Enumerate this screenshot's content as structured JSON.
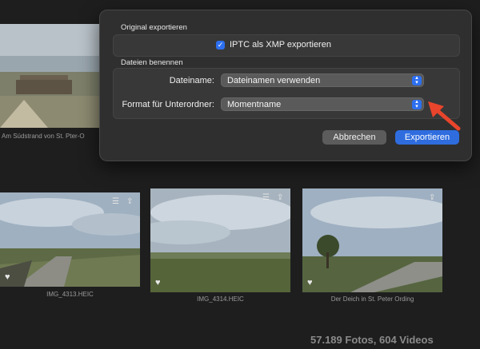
{
  "dialog": {
    "section_original": "Original exportieren",
    "iptc_label": "IPTC als XMP exportieren",
    "iptc_checked": true,
    "section_files": "Dateien benennen",
    "filename_label": "Dateiname:",
    "filename_value": "Dateinamen verwenden",
    "subfolder_label": "Format für Unterordner:",
    "subfolder_value": "Momentname",
    "cancel_label": "Abbrechen",
    "export_label": "Exportieren"
  },
  "background_photos": {
    "top_caption": "Am Südstrand von St. Pter-O",
    "photos": [
      {
        "caption": "IMG_4313.HEIC"
      },
      {
        "caption": "IMG_4314.HEIC"
      },
      {
        "caption": "Der Deich in St. Peter Ording"
      }
    ]
  },
  "footer": {
    "count": "57.189 Fotos, 604 Videos"
  },
  "icons": {
    "check": "✓",
    "heart": "♥",
    "stepper": "▴▾"
  }
}
